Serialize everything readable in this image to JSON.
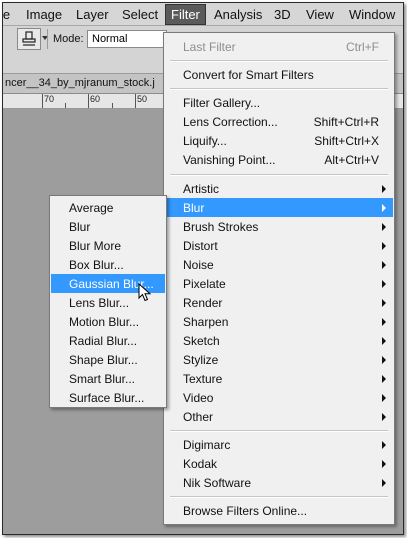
{
  "menubar": {
    "items": [
      {
        "label": "le"
      },
      {
        "label": "Image"
      },
      {
        "label": "Layer"
      },
      {
        "label": "Select"
      },
      {
        "label": "Filter"
      },
      {
        "label": "Analysis"
      },
      {
        "label": "3D"
      },
      {
        "label": "View"
      },
      {
        "label": "Window"
      }
    ]
  },
  "options": {
    "mode_label": "Mode:",
    "mode_value": "Normal",
    "tool_icon": "clone-stamp-icon"
  },
  "document": {
    "tab_label": "ncer__34_by_mjranum_stock.j"
  },
  "ruler": {
    "numbers": [
      "70",
      "60",
      "50"
    ]
  },
  "filter_menu": {
    "last_filter": {
      "label": "Last Filter",
      "shortcut": "Ctrl+F"
    },
    "convert": {
      "label": "Convert for Smart Filters"
    },
    "gallery": {
      "label": "Filter Gallery..."
    },
    "lens_correction": {
      "label": "Lens Correction...",
      "shortcut": "Shift+Ctrl+R"
    },
    "liquify": {
      "label": "Liquify...",
      "shortcut": "Shift+Ctrl+X"
    },
    "vanishing_point": {
      "label": "Vanishing Point...",
      "shortcut": "Alt+Ctrl+V"
    },
    "groups": [
      "Artistic",
      "Blur",
      "Brush Strokes",
      "Distort",
      "Noise",
      "Pixelate",
      "Render",
      "Sharpen",
      "Sketch",
      "Stylize",
      "Texture",
      "Video",
      "Other"
    ],
    "plugins": [
      "Digimarc",
      "Kodak",
      "Nik Software"
    ],
    "browse": {
      "label": "Browse Filters Online..."
    }
  },
  "blur_menu": {
    "items": [
      "Average",
      "Blur",
      "Blur More",
      "Box Blur...",
      "Gaussian Blur...",
      "Lens Blur...",
      "Motion Blur...",
      "Radial Blur...",
      "Shape Blur...",
      "Smart Blur...",
      "Surface Blur..."
    ]
  },
  "colors": {
    "highlight": "#3399ff",
    "menu_bg": "#f0f0f0",
    "active_menu": "#5a5a5a"
  }
}
